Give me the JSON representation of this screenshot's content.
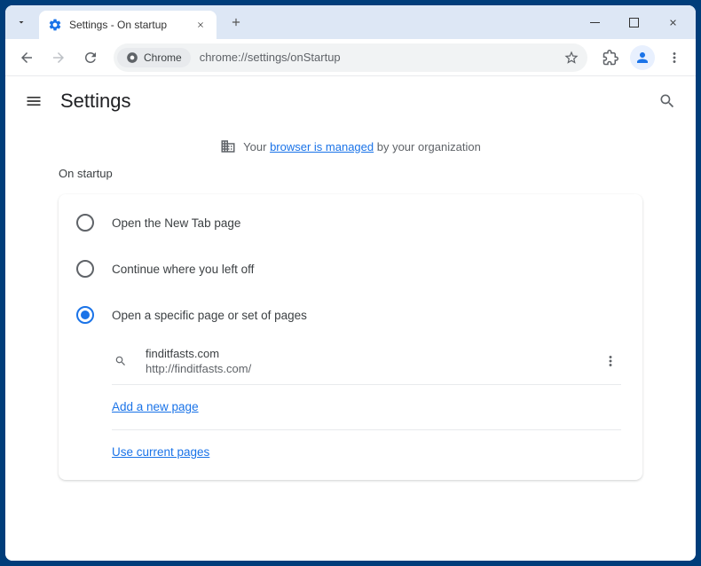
{
  "tab": {
    "title": "Settings - On startup"
  },
  "toolbar": {
    "site_label": "Chrome",
    "url": "chrome://settings/onStartup"
  },
  "header": {
    "title": "Settings"
  },
  "managed": {
    "before": "Your ",
    "link": "browser is managed",
    "after": " by your organization"
  },
  "section": {
    "title": "On startup",
    "options": [
      {
        "label": "Open the New Tab page",
        "checked": false
      },
      {
        "label": "Continue where you left off",
        "checked": false
      },
      {
        "label": "Open a specific page or set of pages",
        "checked": true
      }
    ],
    "pages": [
      {
        "name": "finditfasts.com",
        "url": "http://finditfasts.com/"
      }
    ],
    "add_page": "Add a new page",
    "use_current": "Use current pages"
  }
}
